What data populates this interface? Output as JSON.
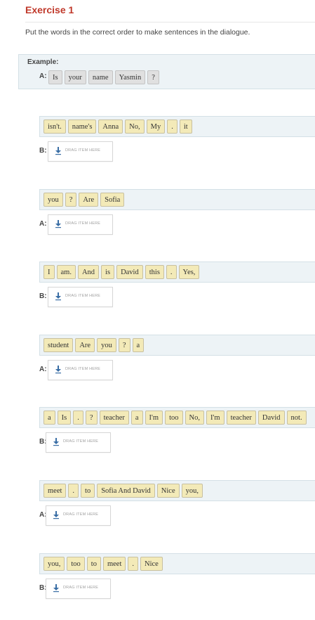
{
  "header": {
    "title": "Exercise 1",
    "instructions": "Put the words in the correct order to make sentences in the dialogue."
  },
  "example": {
    "label": "Example:",
    "speaker": "A:",
    "words": [
      "Is",
      "your",
      "name",
      "Yasmin",
      "?"
    ]
  },
  "drop_placeholder": "DRAG ITEM HERE",
  "colors": {
    "title": "#c0392b",
    "word_yellow": "#f3eab8",
    "word_gray": "#e0e0e0",
    "panel": "#edf3f6"
  },
  "items": [
    {
      "speaker": "B:",
      "words": [
        "isn't.",
        "name's",
        "Anna",
        "No,",
        "My",
        ".",
        "it"
      ]
    },
    {
      "speaker": "A:",
      "words": [
        "you",
        "?",
        "Are",
        "Sofia"
      ]
    },
    {
      "speaker": "B:",
      "words": [
        "I",
        "am.",
        "And",
        "is",
        "David",
        "this",
        ".",
        "Yes,"
      ]
    },
    {
      "speaker": "A:",
      "words": [
        "student",
        "Are",
        "you",
        "?",
        "a"
      ]
    },
    {
      "speaker": "B:",
      "words": [
        "a",
        "Is",
        ".",
        "?",
        "teacher",
        "a",
        "I'm",
        "too",
        "No,",
        "I'm",
        "teacher",
        "David",
        "not."
      ]
    },
    {
      "speaker": "A:",
      "words": [
        "meet",
        ".",
        "to",
        "Sofia And David",
        "Nice",
        "you,"
      ]
    },
    {
      "speaker": "B:",
      "words": [
        "you,",
        "too",
        "to",
        "meet",
        ".",
        "Nice"
      ]
    }
  ]
}
